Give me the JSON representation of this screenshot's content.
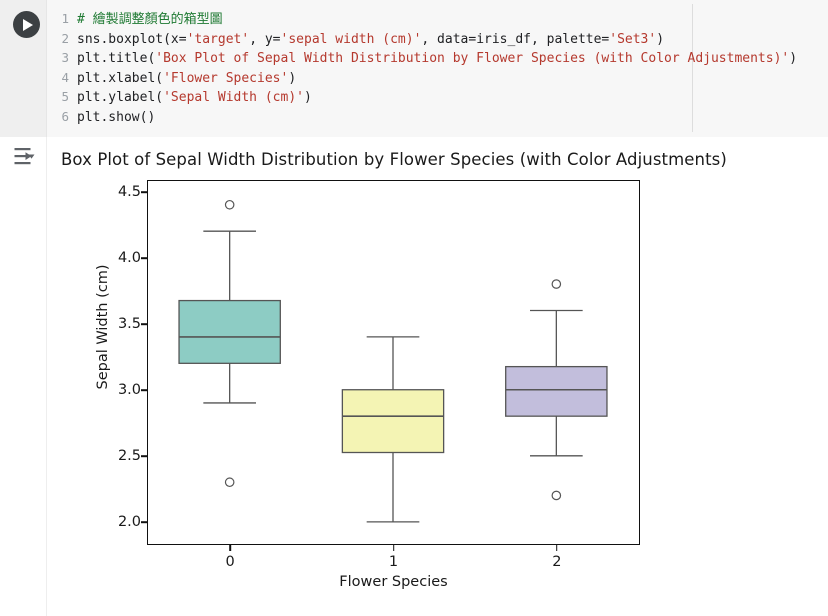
{
  "notebook": {
    "run_button_icon": "play-icon",
    "output_toggle_icon": "output-collapse-icon",
    "code": {
      "language": "python",
      "lines": [
        {
          "number": "1",
          "tokens": [
            {
              "text": "# 繪製調整顏色的箱型圖",
              "type": "comment"
            }
          ]
        },
        {
          "number": "2",
          "tokens": [
            {
              "text": "sns.boxplot(x=",
              "type": "plain"
            },
            {
              "text": "'target'",
              "type": "str"
            },
            {
              "text": ", y=",
              "type": "plain"
            },
            {
              "text": "'sepal width (cm)'",
              "type": "str"
            },
            {
              "text": ", data=iris_df, palette=",
              "type": "plain"
            },
            {
              "text": "'Set3'",
              "type": "str"
            },
            {
              "text": ")",
              "type": "plain"
            }
          ]
        },
        {
          "number": "3",
          "tokens": [
            {
              "text": "plt.title(",
              "type": "plain"
            },
            {
              "text": "'Box Plot of Sepal Width Distribution by Flower Species (with Color Adjustments)'",
              "type": "str"
            },
            {
              "text": ")",
              "type": "plain"
            }
          ]
        },
        {
          "number": "4",
          "tokens": [
            {
              "text": "plt.xlabel(",
              "type": "plain"
            },
            {
              "text": "'Flower Species'",
              "type": "str"
            },
            {
              "text": ")",
              "type": "plain"
            }
          ]
        },
        {
          "number": "5",
          "tokens": [
            {
              "text": "plt.ylabel(",
              "type": "plain"
            },
            {
              "text": "'Sepal Width (cm)'",
              "type": "str"
            },
            {
              "text": ")",
              "type": "plain"
            }
          ]
        },
        {
          "number": "6",
          "tokens": [
            {
              "text": "plt.show()",
              "type": "plain"
            }
          ]
        }
      ]
    }
  },
  "chart_data": {
    "type": "box",
    "title": "Box Plot of Sepal Width Distribution by Flower Species (with Color Adjustments)",
    "xlabel": "Flower Species",
    "ylabel": "Sepal Width (cm)",
    "categories": [
      "0",
      "1",
      "2"
    ],
    "xticklabels": [
      "0",
      "1",
      "2"
    ],
    "yticklabels": [
      "2.0",
      "2.5",
      "3.0",
      "3.5",
      "4.0",
      "4.5"
    ],
    "yticks": [
      2.0,
      2.5,
      3.0,
      3.5,
      4.0,
      4.5
    ],
    "ylim": [
      1.84,
      4.58
    ],
    "grid": false,
    "legend": false,
    "box_edge_color": "#555555",
    "outlier_edge_color": "#555555",
    "boxes": [
      {
        "category": "0",
        "color": "#8dccc4",
        "whisker_low": 2.9,
        "q1": 3.2,
        "median": 3.4,
        "q3": 3.675,
        "whisker_high": 4.2,
        "outliers": [
          4.4,
          2.3
        ]
      },
      {
        "category": "1",
        "color": "#f4f4b4",
        "whisker_low": 2.0,
        "q1": 2.525,
        "median": 2.8,
        "q3": 3.0,
        "whisker_high": 3.4,
        "outliers": []
      },
      {
        "category": "2",
        "color": "#c2bedc",
        "whisker_low": 2.5,
        "q1": 2.8,
        "median": 3.0,
        "q3": 3.175,
        "whisker_high": 3.6,
        "outliers": [
          3.8,
          2.2
        ]
      }
    ]
  }
}
